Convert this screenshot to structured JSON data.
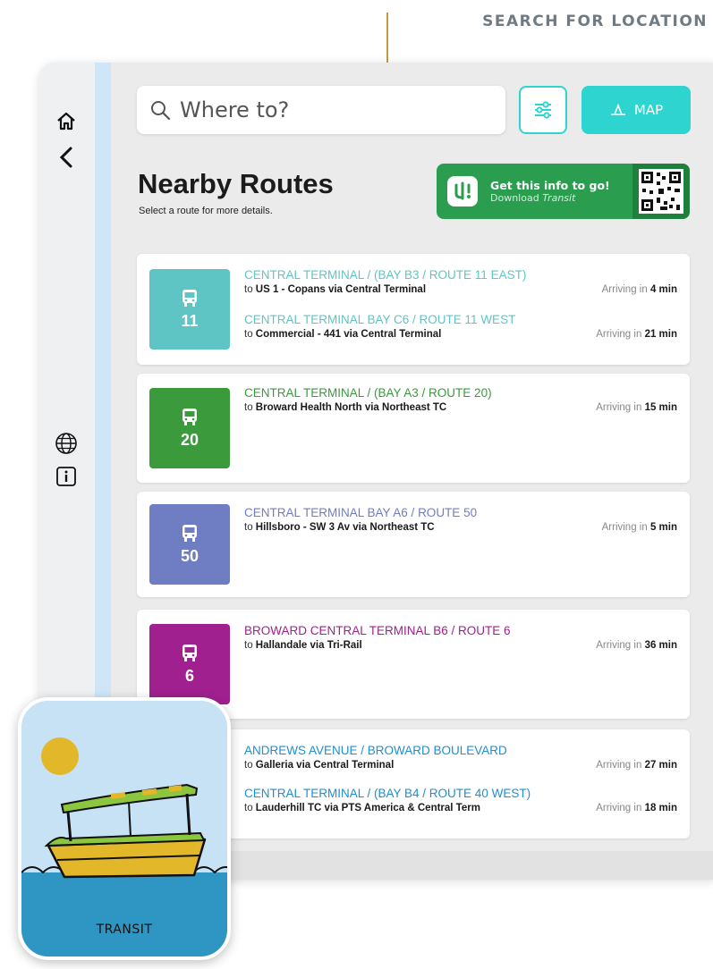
{
  "callout": {
    "label": "SEARCH FOR LOCATION"
  },
  "search": {
    "placeholder": "Where to?"
  },
  "map_button": {
    "label": "MAP"
  },
  "header": {
    "title": "Nearby Routes",
    "subtitle": "Select a route for more details."
  },
  "promo": {
    "title": "Get this info to go!",
    "subtitle_prefix": "Download",
    "subtitle_brand": "Transit"
  },
  "routes": [
    {
      "number": "11",
      "color": "#5fc4c4",
      "lines": [
        {
          "title": "CENTRAL TERMINAL / (BAY B3 / ROUTE 11 EAST)",
          "to": "to",
          "destination": "US 1 - Copans via Central Terminal",
          "arriving": "Arriving in",
          "minutes": "4 min"
        },
        {
          "title": "CENTRAL TERMINAL BAY C6 / ROUTE 11 WEST",
          "to": "to",
          "destination": "Commercial - 441 via Central Terminal",
          "arriving": "Arriving in",
          "minutes": "21 min"
        }
      ]
    },
    {
      "number": "20",
      "color": "#3a9a3c",
      "lines": [
        {
          "title": "CENTRAL TERMINAL / (BAY A3 / ROUTE 20)",
          "to": "to",
          "destination": "Broward Health North via Northeast TC",
          "arriving": "Arriving in",
          "minutes": "15 min"
        }
      ]
    },
    {
      "number": "50",
      "color": "#6f7dc2",
      "lines": [
        {
          "title": "CENTRAL TERMINAL BAY A6 / ROUTE 50",
          "to": "to",
          "destination": "Hillsboro - SW 3 Av via Northeast TC",
          "arriving": "Arriving in",
          "minutes": "5 min"
        }
      ]
    },
    {
      "number": "6",
      "color": "#a0208f",
      "lines": [
        {
          "title": "BROWARD CENTRAL TERMINAL B6 / ROUTE 6",
          "to": "to",
          "destination": "Hallandale via Tri-Rail",
          "arriving": "Arriving in",
          "minutes": "36 min"
        }
      ]
    },
    {
      "number": "",
      "color": "#1e8fd0",
      "lines": [
        {
          "title": "ANDREWS AVENUE / BROWARD BOULEVARD",
          "to": "to",
          "destination": "Galleria via Central Terminal",
          "arriving": "Arriving in",
          "minutes": "27 min"
        },
        {
          "title": "CENTRAL TERMINAL / (BAY B4 / ROUTE 40 WEST)",
          "to": "to",
          "destination": "Lauderhill TC via PTS America & Central Term",
          "arriving": "Arriving in",
          "minutes": "18 min"
        }
      ]
    }
  ],
  "app_icon": {
    "label": "TRANSIT"
  },
  "icons": {
    "home": "home-icon",
    "back": "chevron-left-icon",
    "globe": "globe-icon",
    "info": "info-icon",
    "search": "search-icon",
    "filter": "sliders-icon",
    "map": "map-icon",
    "bus": "bus-icon",
    "qr": "qr-code-icon"
  }
}
